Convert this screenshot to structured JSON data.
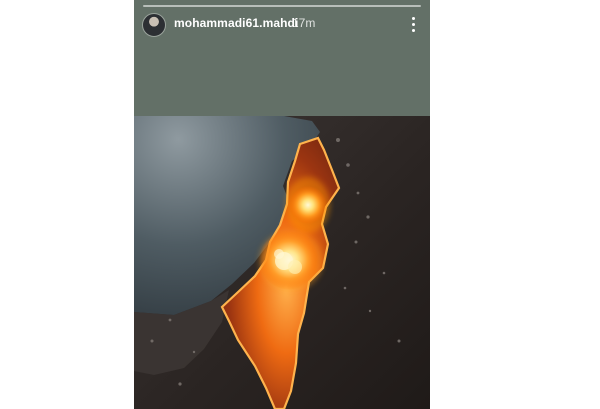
{
  "story": {
    "username": "mohammadi61.mahdi",
    "time_ago": "17m",
    "avatar_icon": "profile-avatar",
    "menu_icon": "more-vertical-icon",
    "progress": 1.0
  },
  "colors": {
    "header_bg": "#637067",
    "page_bg": "#ffffff",
    "text": "#ffffff"
  },
  "media": {
    "image_icon": "story-image"
  }
}
